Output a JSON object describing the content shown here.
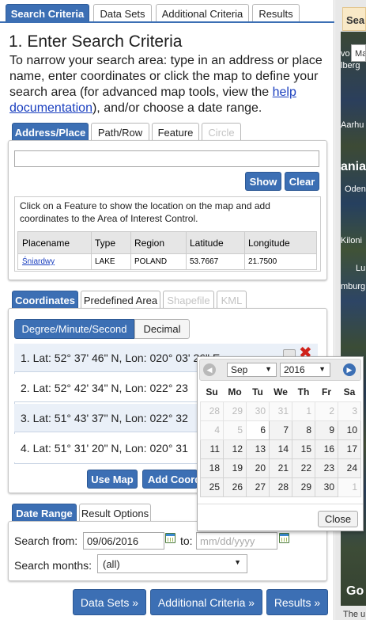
{
  "main_tabs": [
    "Search Criteria",
    "Data Sets",
    "Additional Criteria",
    "Results"
  ],
  "heading": "1. Enter Search Criteria",
  "intro": {
    "text_before": "To narrow your search area: type in an address or place name, enter coordinates or click the map to define your search area (for advanced map tools, view the ",
    "link": "help documentation",
    "text_after": "), and/or choose a date range."
  },
  "address_tabs": [
    "Address/Place",
    "Path/Row",
    "Feature",
    "Circle"
  ],
  "address": {
    "value": "",
    "show": "Show",
    "clear": "Clear"
  },
  "feature": {
    "hint": "Click on a Feature to show the location on the map and add coordinates to the Area of Interest Control.",
    "columns": [
      "Placename",
      "Type",
      "Region",
      "Latitude",
      "Longitude"
    ],
    "row": {
      "placename": "Śniardwy",
      "type": "LAKE",
      "region": "POLAND",
      "latitude": "53.7667",
      "longitude": "21.7500"
    }
  },
  "coord_tabs": [
    "Coordinates",
    "Predefined Area",
    "Shapefile",
    "KML"
  ],
  "format_toggle": [
    "Degree/Minute/Second",
    "Decimal"
  ],
  "coordinates": [
    "1.  Lat: 52° 37' 46\" N, Lon: 020° 03' 26\" E",
    "2.  Lat: 52° 42' 34\" N, Lon: 022° 23",
    "3.  Lat: 51° 43' 37\" N, Lon: 022° 32",
    "4.  Lat: 51° 31' 20\" N, Lon: 020° 31"
  ],
  "coord_buttons": {
    "use_map": "Use Map",
    "add_coord": "Add Coord"
  },
  "date_tabs": [
    "Date Range",
    "Result Options"
  ],
  "date": {
    "from_label": "Search from:",
    "from_value": "09/06/2016",
    "to_label": "to:",
    "to_placeholder": "mm/dd/yyyy",
    "months_label": "Search months:",
    "months_value": "(all)"
  },
  "nav_buttons": {
    "data_sets": "Data Sets »",
    "additional": "Additional Criteria »",
    "results": "Results »"
  },
  "datepicker": {
    "month": "Sep",
    "year": "2016",
    "weekdays": [
      "Su",
      "Mo",
      "Tu",
      "We",
      "Th",
      "Fr",
      "Sa"
    ],
    "weeks": [
      [
        "28",
        "29",
        "30",
        "31",
        "1",
        "2",
        "3"
      ],
      [
        "4",
        "5",
        "6",
        "7",
        "8",
        "9",
        "10"
      ],
      [
        "11",
        "12",
        "13",
        "14",
        "15",
        "16",
        "17"
      ],
      [
        "18",
        "19",
        "20",
        "21",
        "22",
        "23",
        "24"
      ],
      [
        "25",
        "26",
        "27",
        "28",
        "29",
        "30",
        "1"
      ]
    ],
    "close": "Close"
  },
  "map": {
    "search_tab": "Sea",
    "input_text": "Ma",
    "labels": [
      "vo",
      "lberg",
      "Aarhu",
      "ania",
      "Oden",
      "Kiloni",
      "Lu",
      "mburg"
    ],
    "google": "Go",
    "footer": "The u"
  },
  "colors": {
    "accent": "#3c6fb4",
    "map_water": "#29456a",
    "map_land": "#3c4a3a"
  }
}
